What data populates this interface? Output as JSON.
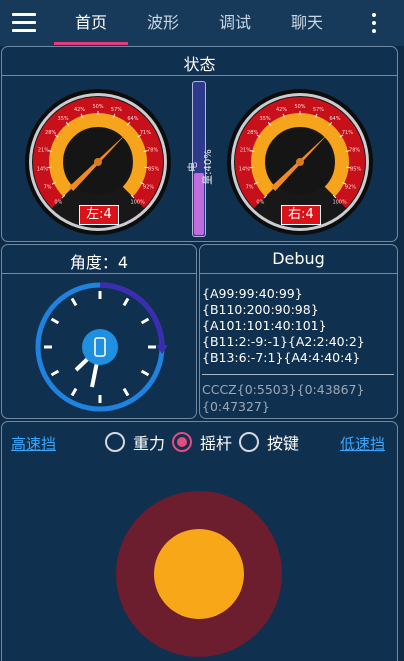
{
  "nav": {
    "tabs": [
      {
        "label": "首页",
        "active": true
      },
      {
        "label": "波形",
        "active": false
      },
      {
        "label": "调试",
        "active": false
      },
      {
        "label": "聊天",
        "active": false
      }
    ],
    "menu_icon": "hamburger-menu-icon",
    "overflow_icon": "more-vertical-icon"
  },
  "status": {
    "title": "状态",
    "left_gauge": {
      "label": "左:4",
      "value": 4
    },
    "right_gauge": {
      "label": "右:4",
      "value": 4
    },
    "gauge_ticks": [
      "0%",
      "7%",
      "14%",
      "21%",
      "28%",
      "35%",
      "42%",
      "50%",
      "57%",
      "64%",
      "71%",
      "78%",
      "85%",
      "92%",
      "100%"
    ],
    "battery_text": "电量:40%",
    "battery_fraction": 0.4
  },
  "angle": {
    "title": "角度：4",
    "value": 4
  },
  "debug": {
    "title": "Debug",
    "lines": [
      "{A99:99:40:99}",
      "{B110:200:90:98}",
      "{A101:101:40:101}",
      "{B11:2:-9:-1}{A2:2:40:2}",
      "{B13:6:-7:1}{A4:4:40:4}"
    ],
    "cccz_lines": [
      "CCCZ{0:5503}{0:43867}",
      "{0:47327}"
    ]
  },
  "controls": {
    "high_gear": "高速挡",
    "low_gear": "低速挡",
    "options": [
      {
        "label": "重力",
        "checked": false
      },
      {
        "label": "摇杆",
        "checked": true
      },
      {
        "label": "按键",
        "checked": false
      }
    ]
  },
  "colors": {
    "accent": "#e43a78",
    "link": "#3aa7ff",
    "joystick_outer": "#6c1d2e",
    "joystick_inner": "#f8a719",
    "gauge_needle": "#f08a24"
  }
}
